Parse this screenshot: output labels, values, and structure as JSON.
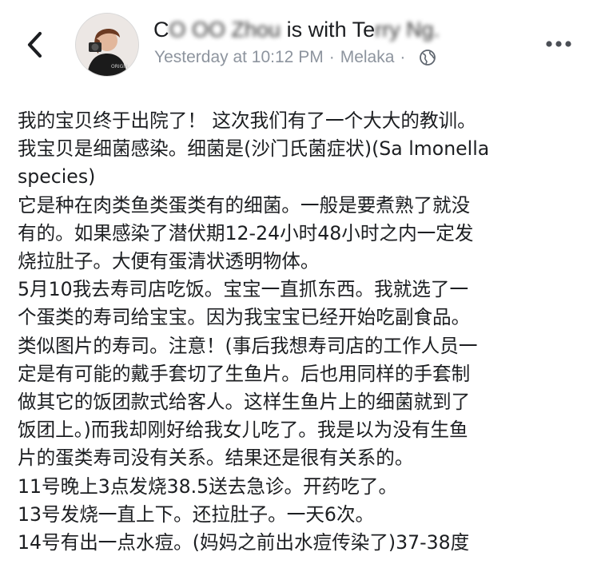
{
  "header": {
    "author_prefix": "C",
    "author_blurred": "O  OO  Zhou",
    "with_text": " is with ",
    "tagged_prefix": "Te",
    "tagged_blurred": "rry  Ng.",
    "timestamp": "Yesterday at 10:12 PM",
    "separator": "·",
    "location": "Melaka",
    "audience_icon": "globe-icon",
    "avatar_shirt_text": "ORIGIN"
  },
  "post": {
    "lines": [
      "我的宝贝终于出院了！ 这次我们有了一个大大的教训。",
      "我宝贝是细菌感染。细菌是(沙门氏菌症状)(Sa lmonella",
      "species)",
      "它是种在肉类鱼类蛋类有的细菌。一般是要煮熟了就没",
      "有的。如果感染了潜伏期12-24小时48小时之内一定发",
      "烧拉肚子。大便有蛋清状透明物体。",
      "5月10我去寿司店吃饭。宝宝一直抓东西。我就选了一",
      "个蛋类的寿司给宝宝。因为我宝宝已经开始吃副食品。",
      "类似图片的寿司。注意！(事后我想寿司店的工作人员一",
      "定是有可能的戴手套切了生鱼片。后也用同样的手套制",
      "做其它的饭团款式给客人。这样生鱼片上的细菌就到了",
      "饭团上。)而我却刚好给我女儿吃了。我是以为没有生鱼",
      "片的蛋类寿司没有关系。结果还是很有关系的。",
      "11号晚上3点发烧38.5送去急诊。开药吃了。",
      "13号发烧一直上下。还拉肚子。一天6次。",
      "14号有出一点水痘。(妈妈之前出水痘传染了)37-38度"
    ]
  },
  "colors": {
    "text": "#1c1e21",
    "secondary": "#8d949e",
    "icon": "#4b4f56"
  }
}
